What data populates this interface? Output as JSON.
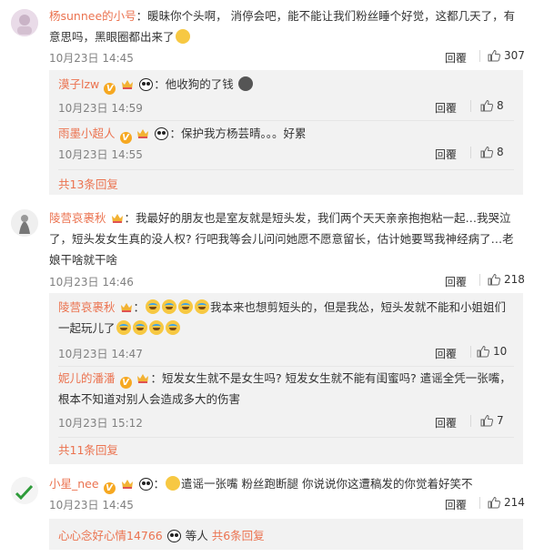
{
  "comments": [
    {
      "user": "杨sunnee的小号",
      "text": "：暖昧你个头啊， 消停会吧，能不能让我们粉丝睡个好觉，这都几天了，有意思吗，黑眼圈都出来了",
      "time": "10月23日 14:45",
      "reply": "回覆",
      "likes": "307",
      "avatar": "pink-avatar"
    },
    {
      "user": "陵营哀裹秋",
      "text": "：我最好的朋友也是室友就是短头发，我们两个天天亲亲抱抱粘一起…我哭泣了，短头发女生真的没人权? 行吧我等会儿问问她愿不愿意留长，估计她要骂我神经病了…老娘干啥就干啥",
      "time": "10月23日 14:46",
      "reply": "回覆",
      "likes": "218",
      "avatar": "gray-avatar"
    },
    {
      "user": "小星_nee",
      "text": "遣谣一张嘴 粉丝跑断腿  你说说你这遭稿发的你觉着好笑不",
      "time": "10月23日 14:45",
      "reply": "回覆",
      "likes": "214",
      "avatar": "green-avatar"
    }
  ],
  "subs1": [
    {
      "user": "漠子lzw",
      "text": "他收狗的了钱",
      "time": "10月23日 14:59",
      "reply": "回覆",
      "likes": "8"
    },
    {
      "user": "雨墨小超人",
      "text": "保护我方杨芸晴。。。好累",
      "time": "10月23日 14:55",
      "reply": "回覆",
      "likes": "8"
    }
  ],
  "subs1_more": "共13条回复",
  "subs2": [
    {
      "user": "陵营哀裹秋",
      "text_a": "我本来也想剪短头的，但是我怂，短头发就不能和小姐姐们一",
      "text_b": "起玩儿了",
      "time": "10月23日 14:47",
      "reply": "回覆",
      "likes": "10"
    },
    {
      "user": "妮儿的潘潘",
      "text": "短发女生就不是女生吗? 短发女生就不能有闺蜜吗? 遣谣全凭一张嘴，根本不知道对别人会造成多大的伤害",
      "time": "10月23日 15:12",
      "reply": "回覆",
      "likes": "7"
    }
  ],
  "subs2_more": "共11条回复",
  "subs3_line": {
    "user": "心心念好心情14766",
    "mid": "等人",
    "more": "共6条回复"
  },
  "colors": {
    "accent": "#eb7350",
    "sub_bg": "#f2f2f2"
  }
}
